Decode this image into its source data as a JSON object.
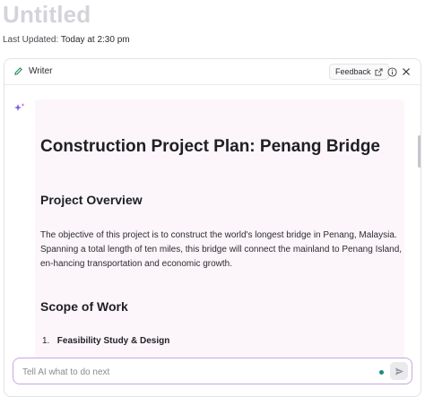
{
  "page": {
    "title": "Untitled",
    "last_updated_label": "Last Updated:",
    "last_updated_value": "Today at 2:30 pm"
  },
  "writer": {
    "label": "Writer",
    "feedback_label": "Feedback",
    "icons": {
      "pencil": "pencil-icon",
      "external": "external-link-icon",
      "info": "info-icon",
      "close": "close-icon",
      "sparkle": "sparkle-icon",
      "send": "send-icon"
    }
  },
  "document": {
    "title": "Construction Project Plan: Penang Bridge",
    "sections": [
      {
        "heading": "Project Overview",
        "paragraph": "The objective of this project is to construct the world's longest bridge in Penang, Malaysia. Spanning a total length of ten miles, this bridge will connect the mainland to Penang Island, en-hancing transportation and economic growth."
      },
      {
        "heading": "Scope of Work",
        "list": [
          {
            "number": "1.",
            "text": "Feasibility Study & Design"
          }
        ]
      }
    ]
  },
  "prompt": {
    "placeholder": "Tell AI what to do next",
    "value": ""
  },
  "colors": {
    "accent_border": "#c9a6dd",
    "doc_background": "#fcf6fb",
    "status_dot": "#1f8a7a",
    "title_muted": "#d3d3d9"
  }
}
